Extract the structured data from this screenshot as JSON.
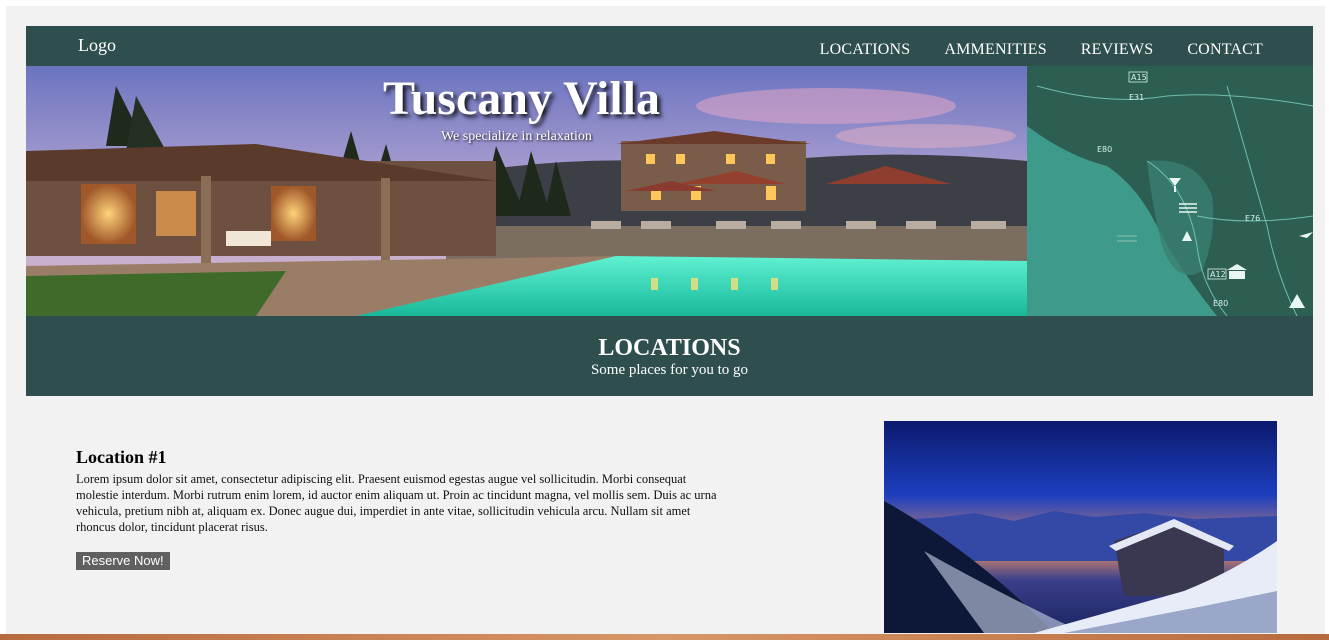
{
  "header": {
    "logo": "Logo",
    "nav": [
      "LOCATIONS",
      "AMMENITIES",
      "REVIEWS",
      "CONTACT"
    ]
  },
  "hero": {
    "title": "Tuscany Villa",
    "subtitle": "We specialize in relaxation"
  },
  "map": {
    "road_labels": [
      "A15",
      "E31",
      "E80",
      "E76",
      "A12",
      "E80"
    ]
  },
  "section": {
    "title": "LOCATIONS",
    "subtitle": "Some places for you to go"
  },
  "location1": {
    "title": "Location #1",
    "text": "Lorem ipsum dolor sit amet, consectetur adipiscing elit. Praesent euismod egestas augue vel sollicitudin. Morbi consequat molestie interdum. Morbi rutrum enim lorem, id auctor enim aliquam ut. Proin ac tincidunt magna, vel mollis sem. Duis ac urna vehicula, pretium nibh at, aliquam ex. Donec augue dui, imperdiet in ante vitae, sollicitudin vehicula arcu. Nullam sit amet rhoncus dolor, tincidunt placerat risus.",
    "button": "Reserve Now!"
  },
  "colors": {
    "header_bg": "#2f4f4f",
    "page_bg": "#f2f2f2",
    "button_bg": "#606060"
  }
}
